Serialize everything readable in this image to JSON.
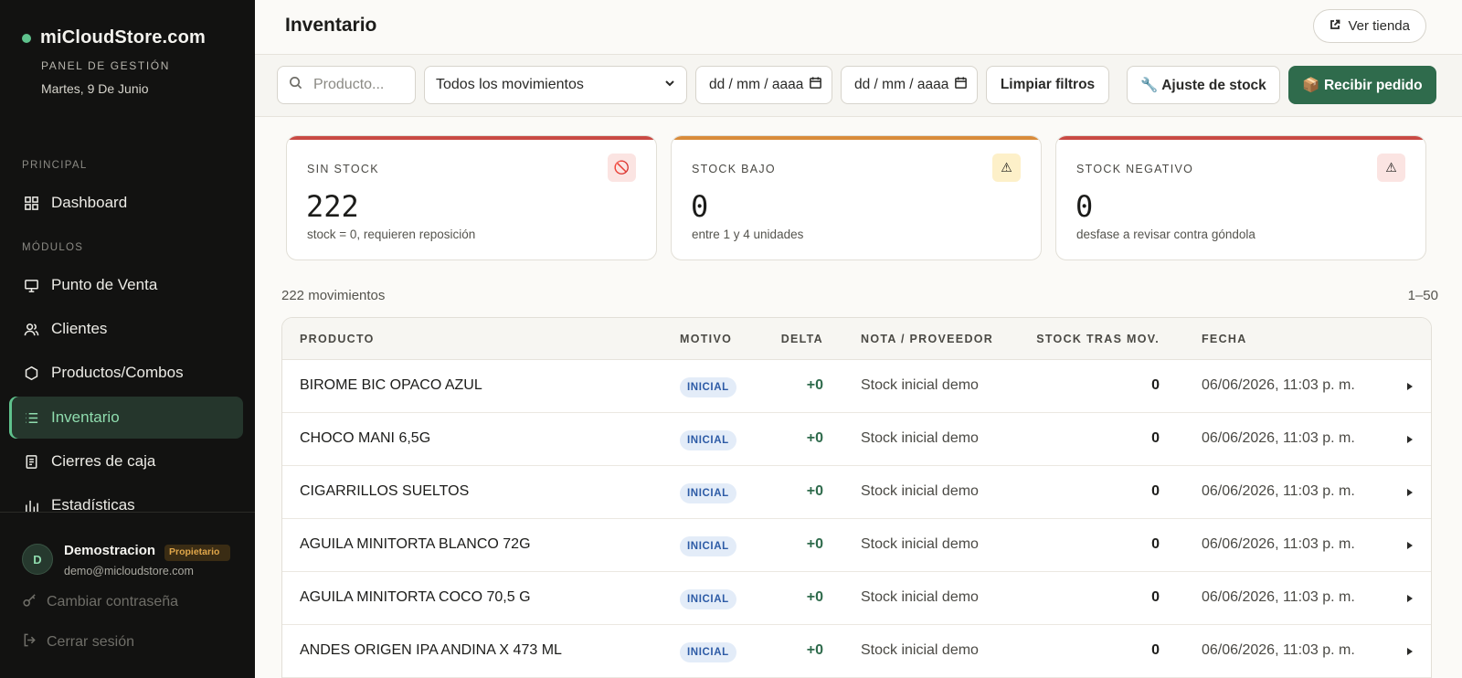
{
  "brand": {
    "name": "miCloudStore.com",
    "subtitle": "PANEL DE GESTIÓN",
    "date": "Martes, 9 De Junio"
  },
  "sidebar": {
    "section_principal": "PRINCIPAL",
    "section_modulos": "MÓDULOS",
    "items": [
      {
        "label": "Dashboard",
        "icon": "grid-icon"
      },
      {
        "label": "Punto de Venta",
        "icon": "monitor-icon"
      },
      {
        "label": "Clientes",
        "icon": "users-icon"
      },
      {
        "label": "Productos/Combos",
        "icon": "hexagon-icon"
      },
      {
        "label": "Inventario",
        "icon": "list-icon",
        "active": true
      },
      {
        "label": "Cierres de caja",
        "icon": "receipt-icon"
      },
      {
        "label": "Estadísticas",
        "icon": "bar-chart-icon"
      }
    ]
  },
  "user": {
    "initial": "D",
    "name": "Demostracion",
    "role": "Propietario",
    "email": "demo@micloudstore.com",
    "change_password": "Cambiar contraseña",
    "logout": "Cerrar sesión"
  },
  "header": {
    "title": "Inventario",
    "view_store": "Ver tienda"
  },
  "filters": {
    "search_placeholder": "Producto...",
    "movement_select": "Todos los movimientos",
    "date_from": "dd / mm / aaaa",
    "date_to": "dd / mm / aaaa",
    "clear": "Limpiar filtros",
    "adjust": "🔧 Ajuste de stock",
    "receive": "📦 Recibir pedido"
  },
  "stats": [
    {
      "label": "SIN STOCK",
      "value": "222",
      "hint": "stock = 0, requieren reposición",
      "icon": "🚫",
      "accent": "#c94a44",
      "icon_bg": "#fbe4e2"
    },
    {
      "label": "STOCK BAJO",
      "value": "0",
      "hint": "entre 1 y 4 unidades",
      "icon": "⚠",
      "accent": "#d98b3a",
      "icon_bg": "#fdf0c9"
    },
    {
      "label": "STOCK NEGATIVO",
      "value": "0",
      "hint": "desfase a revisar contra góndola",
      "icon": "⚠",
      "accent": "#c94a44",
      "icon_bg": "#fbe4e2"
    }
  ],
  "list": {
    "count": "222 movimientos",
    "range": "1–50"
  },
  "table": {
    "headers": [
      "PRODUCTO",
      "MOTIVO",
      "DELTA",
      "NOTA / PROVEEDOR",
      "STOCK TRAS MOV.",
      "FECHA"
    ],
    "rows": [
      {
        "product": "BIROME BIC OPACO AZUL",
        "motivo": "INICIAL",
        "delta": "+0",
        "nota": "Stock inicial demo",
        "stock": "0",
        "fecha": "06/06/2026, 11:03 p. m."
      },
      {
        "product": "CHOCO MANI 6,5G",
        "motivo": "INICIAL",
        "delta": "+0",
        "nota": "Stock inicial demo",
        "stock": "0",
        "fecha": "06/06/2026, 11:03 p. m."
      },
      {
        "product": "CIGARRILLOS SUELTOS",
        "motivo": "INICIAL",
        "delta": "+0",
        "nota": "Stock inicial demo",
        "stock": "0",
        "fecha": "06/06/2026, 11:03 p. m."
      },
      {
        "product": "AGUILA MINITORTA BLANCO 72G",
        "motivo": "INICIAL",
        "delta": "+0",
        "nota": "Stock inicial demo",
        "stock": "0",
        "fecha": "06/06/2026, 11:03 p. m."
      },
      {
        "product": "AGUILA MINITORTA COCO 70,5 G",
        "motivo": "INICIAL",
        "delta": "+0",
        "nota": "Stock inicial demo",
        "stock": "0",
        "fecha": "06/06/2026, 11:03 p. m."
      },
      {
        "product": "ANDES ORIGEN IPA ANDINA X 473 ML",
        "motivo": "INICIAL",
        "delta": "+0",
        "nota": "Stock inicial demo",
        "stock": "0",
        "fecha": "06/06/2026, 11:03 p. m."
      }
    ]
  }
}
